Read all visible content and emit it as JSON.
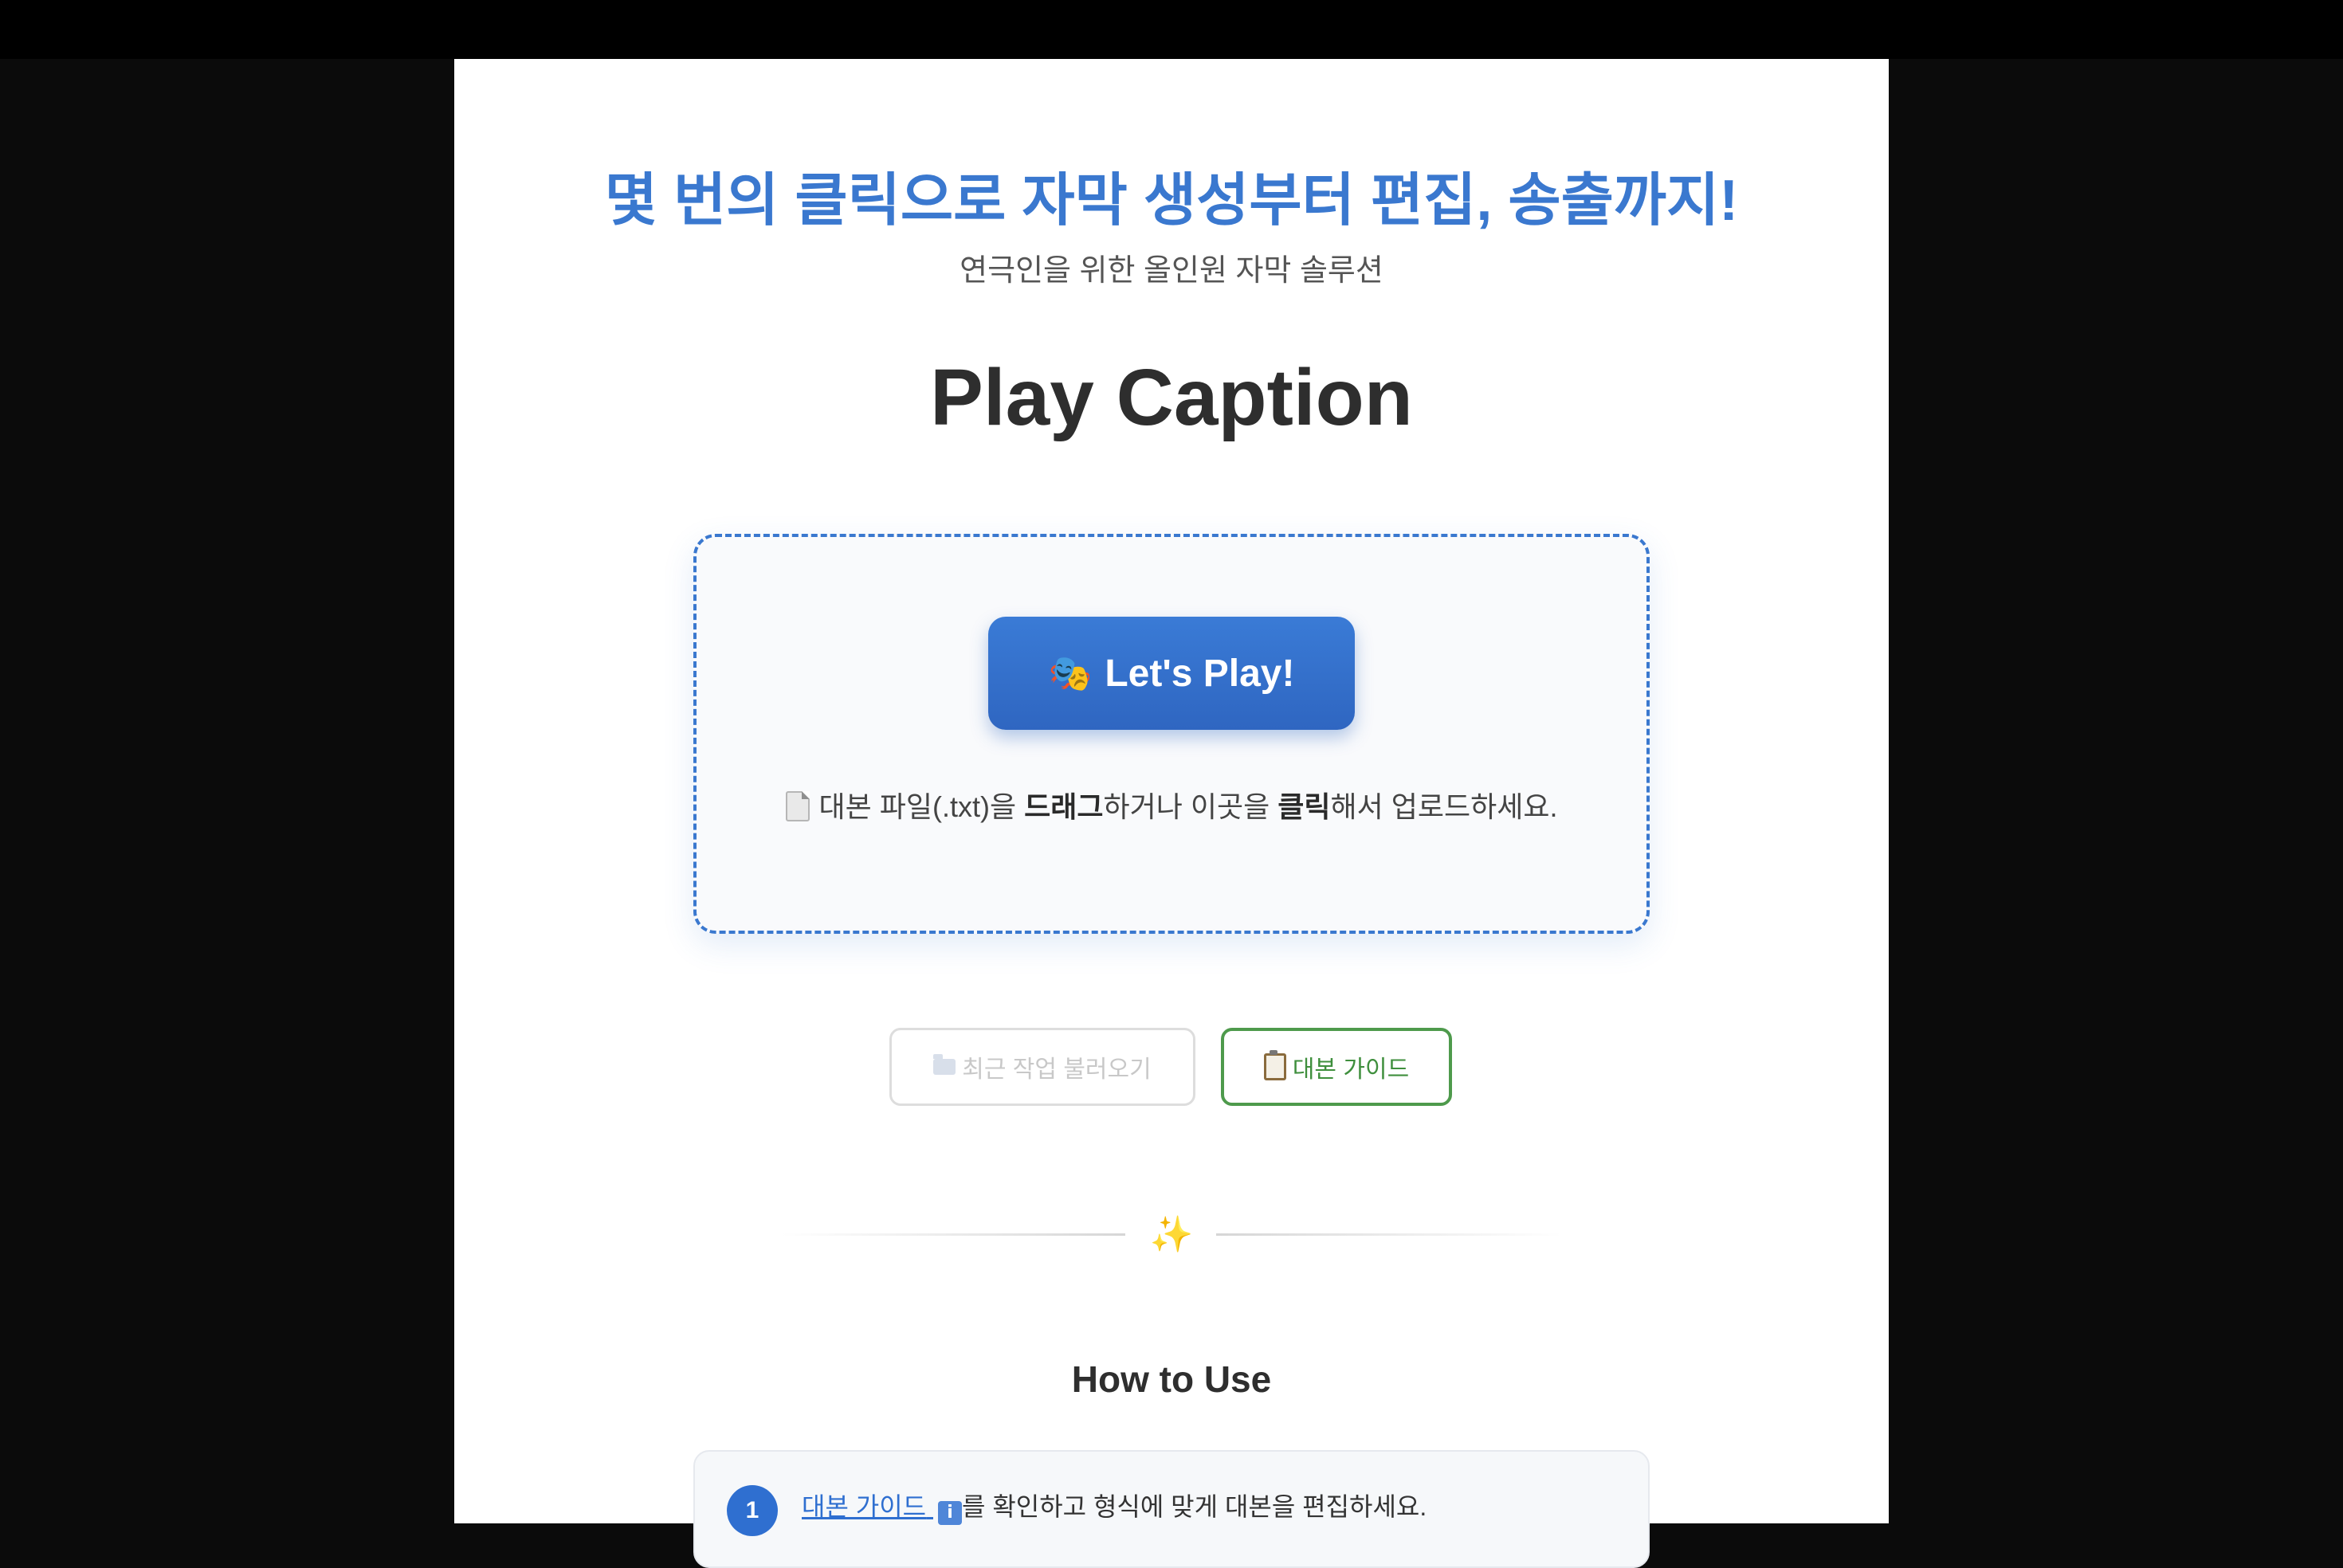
{
  "hero": {
    "headline": "몇 번의 클릭으로 자막 생성부터 편집, 송출까지!",
    "subtitle": "연극인을 위한 올인원 자막 솔루션",
    "brand": "Play Caption"
  },
  "upload": {
    "play_button_label": "Let's Play!",
    "hint_pre": "대본 파일(.txt)을 ",
    "hint_drag": "드래그",
    "hint_mid": "하거나 이곳을 ",
    "hint_click": "클릭",
    "hint_post": "해서 업로드하세요."
  },
  "actions": {
    "recent_label": "최근 작업 불러오기",
    "guide_label": "대본 가이드"
  },
  "icons": {
    "play_button_icon": "performing-arts-icon",
    "hint_icon": "document-icon",
    "recent_icon": "folder-icon",
    "guide_icon": "clipboard-icon",
    "divider_icon": "sparkles-icon",
    "info_icon": "info-icon"
  },
  "how_to": {
    "title": "How to Use",
    "steps": [
      {
        "number": "1",
        "link_text": "대본 가이드",
        "text": "를 확인하고 형식에 맞게 대본을 편집하세요."
      }
    ]
  },
  "colors": {
    "accent_blue": "#3a78cf",
    "guide_green": "#4e9a4c",
    "disabled_gray": "#c8c8c8"
  }
}
